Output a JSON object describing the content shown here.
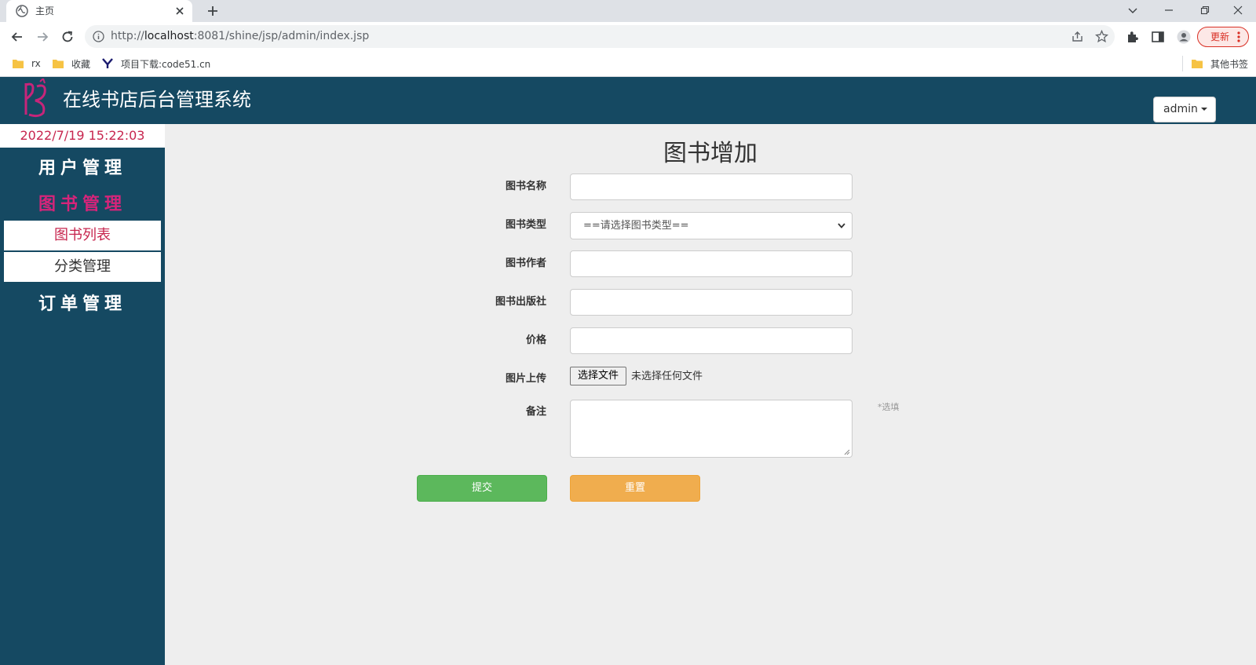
{
  "browser": {
    "tab_title": "主页",
    "url_prefix": "http://",
    "url_host": "localhost",
    "url_path": ":8081/shine/jsp/admin/index.jsp",
    "update_label": "更新",
    "bookmarks": [
      "rx",
      "收藏",
      "项目下载:code51.cn"
    ],
    "other_bookmarks": "其他书签"
  },
  "app": {
    "title": "在线书店后台管理系统",
    "admin_label": "admin",
    "clock": "2022/7/19 15:22:03"
  },
  "sidebar": {
    "user_mgmt": "用户管理",
    "book_mgmt": "图书管理",
    "book_list": "图书列表",
    "category_mgmt": "分类管理",
    "order_mgmt": "订单管理"
  },
  "form": {
    "title": "图书增加",
    "label_name": "图书名称",
    "label_type": "图书类型",
    "type_selected": "==请选择图书类型==",
    "label_author": "图书作者",
    "label_publisher": "图书出版社",
    "label_price": "价格",
    "label_image": "图片上传",
    "file_button": "选择文件",
    "file_status": "未选择任何文件",
    "label_note": "备注",
    "note_hint": "*选填",
    "submit": "提交",
    "reset": "重置"
  },
  "colors": {
    "header_bg": "#154962",
    "accent_pink": "#c7254e",
    "submit_green": "#5cb85c",
    "reset_orange": "#f0ad4e"
  }
}
